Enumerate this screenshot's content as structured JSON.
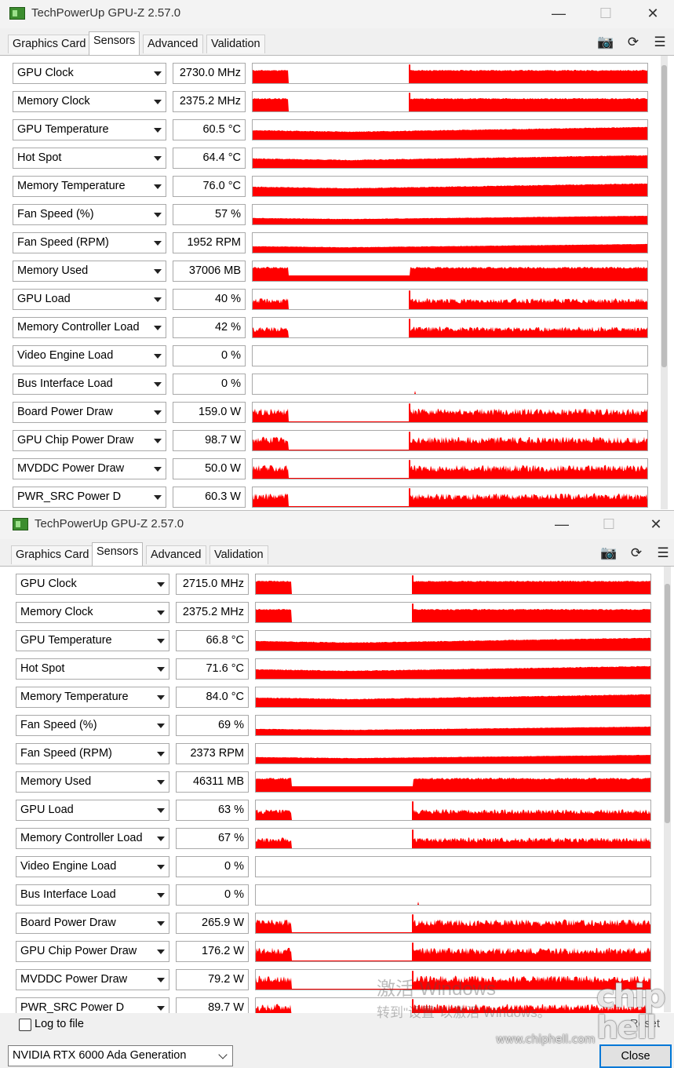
{
  "tabs": [
    "Graphics Card",
    "Sensors",
    "Advanced",
    "Validation"
  ],
  "windowA": {
    "title": "TechPowerUp GPU-Z 2.57.0",
    "sensors": [
      {
        "name": "GPU Clock",
        "value": "2730.0 MHz"
      },
      {
        "name": "Memory Clock",
        "value": "2375.2 MHz"
      },
      {
        "name": "GPU Temperature",
        "value": "60.5 °C"
      },
      {
        "name": "Hot Spot",
        "value": "64.4 °C"
      },
      {
        "name": "Memory Temperature",
        "value": "76.0 °C"
      },
      {
        "name": "Fan Speed (%)",
        "value": "57 %"
      },
      {
        "name": "Fan Speed (RPM)",
        "value": "1952 RPM"
      },
      {
        "name": "Memory Used",
        "value": "37006 MB"
      },
      {
        "name": "GPU Load",
        "value": "40 %"
      },
      {
        "name": "Memory Controller Load",
        "value": "42 %"
      },
      {
        "name": "Video Engine Load",
        "value": "0 %"
      },
      {
        "name": "Bus Interface Load",
        "value": "0 %"
      },
      {
        "name": "Board Power Draw",
        "value": "159.0 W"
      },
      {
        "name": "GPU Chip Power Draw",
        "value": "98.7 W"
      },
      {
        "name": "MVDDC Power Draw",
        "value": "50.0 W"
      },
      {
        "name": "PWR_SRC Power D",
        "value": "60.3 W"
      }
    ]
  },
  "windowB": {
    "title": "TechPowerUp GPU-Z 2.57.0",
    "sensors": [
      {
        "name": "GPU Clock",
        "value": "2715.0 MHz"
      },
      {
        "name": "Memory Clock",
        "value": "2375.2 MHz"
      },
      {
        "name": "GPU Temperature",
        "value": "66.8 °C"
      },
      {
        "name": "Hot Spot",
        "value": "71.6 °C"
      },
      {
        "name": "Memory Temperature",
        "value": "84.0 °C"
      },
      {
        "name": "Fan Speed (%)",
        "value": "69 %"
      },
      {
        "name": "Fan Speed (RPM)",
        "value": "2373 RPM"
      },
      {
        "name": "Memory Used",
        "value": "46311 MB"
      },
      {
        "name": "GPU Load",
        "value": "63 %"
      },
      {
        "name": "Memory Controller Load",
        "value": "67 %"
      },
      {
        "name": "Video Engine Load",
        "value": "0 %"
      },
      {
        "name": "Bus Interface Load",
        "value": "0 %"
      },
      {
        "name": "Board Power Draw",
        "value": "265.9 W"
      },
      {
        "name": "GPU Chip Power Draw",
        "value": "176.2 W"
      },
      {
        "name": "MVDDC Power Draw",
        "value": "79.2 W"
      },
      {
        "name": "PWR_SRC Power D",
        "value": "89.7 W"
      }
    ],
    "log_label": "Log to file",
    "reset_label": "Reset",
    "gpu_select": "NVIDIA RTX 6000 Ada Generation",
    "close_label": "Close"
  },
  "watermark": {
    "line1": "激活 Windows",
    "line2": "转到\"设置\"以激活 Windows。",
    "site_logo": "chip hell",
    "site_url": "www.chiphell.com"
  },
  "colors": {
    "graph": "#ff0000",
    "accent": "#0078d7"
  }
}
